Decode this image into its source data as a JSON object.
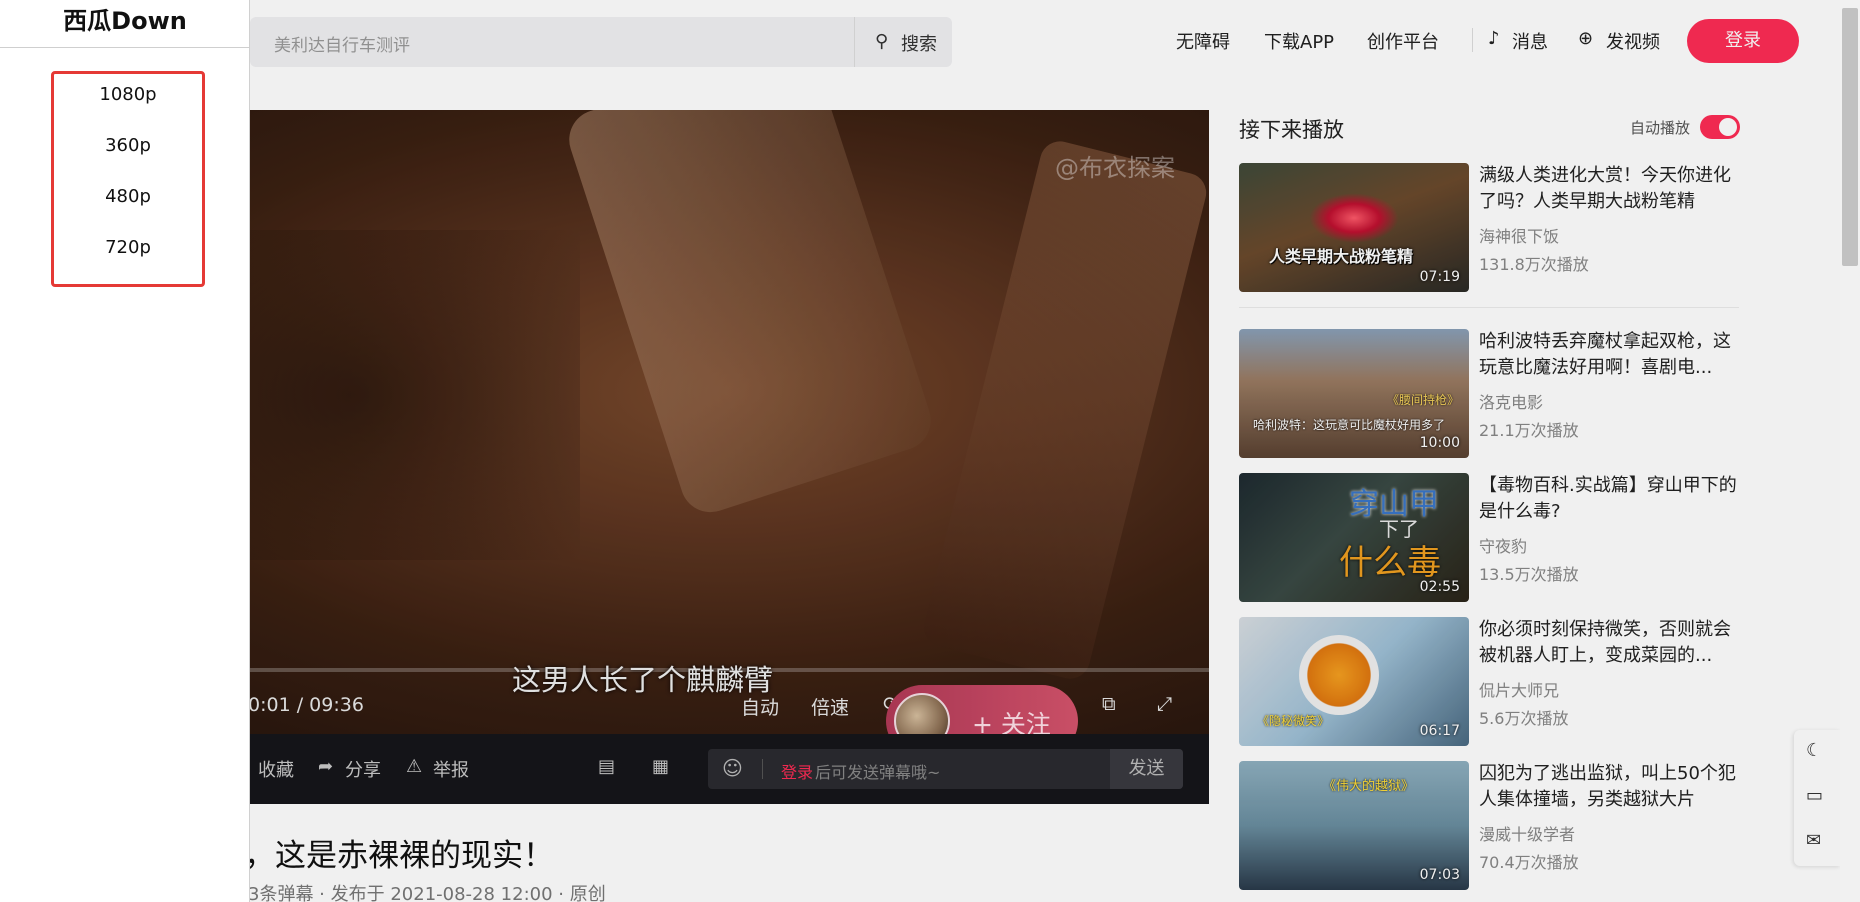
{
  "header": {
    "search_placeholder": "美利达自行车测评",
    "search_button": "搜索",
    "nav": [
      "无障碍",
      "下载APP",
      "创作平台"
    ],
    "notifications": "消息",
    "publish": "发视频",
    "login": "登录"
  },
  "player": {
    "watermark": "@布衣探案",
    "subtitle": "这男人长了个麒麟臂",
    "time": "0:01 / 09:36",
    "controls": {
      "auto": "自动",
      "speed": "倍速"
    },
    "follow_label": "+ 关注"
  },
  "player_bar": {
    "favorite": "收藏",
    "share": "分享",
    "report": "举报",
    "danmaku_login": "登录",
    "danmaku_rest": "后可发送弹幕哦~",
    "send": "发送"
  },
  "video": {
    "title": "，这是赤裸裸的现实！",
    "meta": "3条弹幕 · 发布于 2021-08-28 12:00 · 原创"
  },
  "up_next": {
    "heading": "接下来播放",
    "autoplay_label": "自动播放",
    "autoplay_on": true,
    "items": [
      {
        "title": "满级人类进化大赏！今天你进化了吗？人类早期大战粉笔精",
        "author": "海神很下饭",
        "plays": "131.8万次播放",
        "duration": "07:19",
        "caption": "人类早期大战粉笔精"
      },
      {
        "title": "哈利波特丢弃魔杖拿起双枪，这玩意比魔法好用啊！喜剧电...",
        "author": "洛克电影",
        "plays": "21.1万次播放",
        "duration": "10:00",
        "caption": "哈利波特：这玩意可比魔杖好用多了",
        "tag": "《腰间持枪》"
      },
      {
        "title": "【毒物百科.实战篇】穿山甲下的是什么毒?",
        "author": "守夜豹",
        "plays": "13.5万次播放",
        "duration": "02:55",
        "caption1": "穿山甲",
        "caption2": "下了",
        "caption3": "什么毒"
      },
      {
        "title": "你必须时刻保持微笑，否则就会被机器人盯上，变成菜园的...",
        "author": "侃片大师兄",
        "plays": "5.6万次播放",
        "duration": "06:17",
        "caption": "《隐秘微笑》"
      },
      {
        "title": "囚犯为了逃出监狱，叫上50个犯人集体撞墙，另类越狱大片",
        "author": "漫威十级学者",
        "plays": "70.4万次播放",
        "duration": "07:03",
        "caption": "《伟大的越狱》"
      }
    ]
  },
  "extension": {
    "title": "西瓜Down",
    "options": [
      "1080p",
      "360p",
      "480p",
      "720p"
    ]
  },
  "colors": {
    "accent": "#fe2c55",
    "highlight_box": "#e53935"
  },
  "icons": {
    "search": "search-icon",
    "bell": "bell-icon",
    "plus_circle": "plus-circle-icon",
    "theme": "moon-icon"
  }
}
